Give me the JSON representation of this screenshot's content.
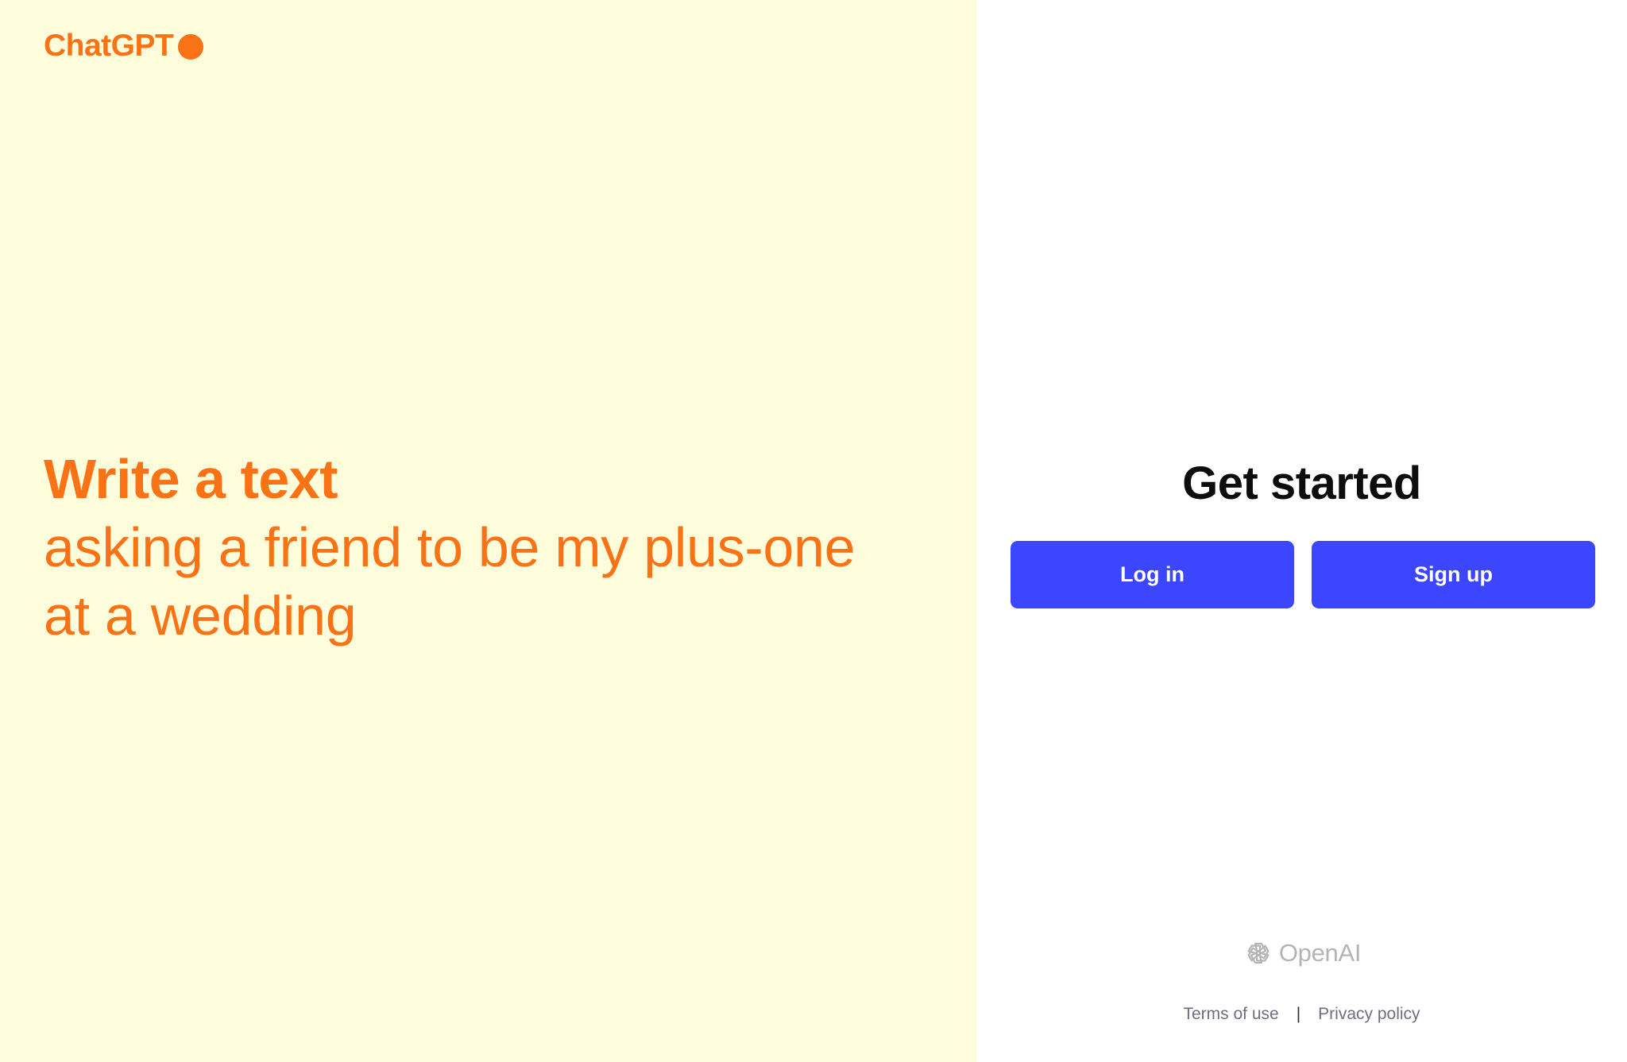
{
  "brand": {
    "name": "ChatGPT",
    "color": "#F97316"
  },
  "hero": {
    "line1": "Write a text",
    "line2": "asking a friend to be my plus-one",
    "line3": "at a wedding",
    "background": "#FEFDDB"
  },
  "auth": {
    "heading": "Get started",
    "login_label": "Log in",
    "signup_label": "Sign up",
    "button_color": "#3C46FF"
  },
  "footer": {
    "logo_text": "OpenAI",
    "logo_icon": "openai-logo-icon",
    "terms_label": "Terms of use",
    "separator": "|",
    "privacy_label": "Privacy policy"
  }
}
